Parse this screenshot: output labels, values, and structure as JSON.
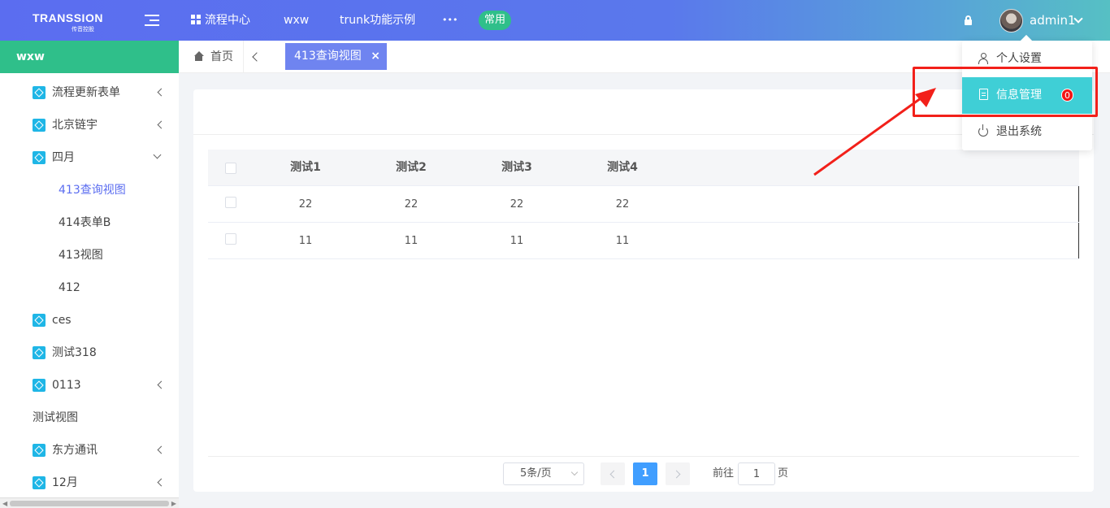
{
  "header": {
    "logo_text": "TRANSSION",
    "logo_subtext": "传音控股",
    "nav": [
      "流程中心",
      "wxw",
      "trunk功能示例",
      "•••"
    ],
    "common_badge": "常用",
    "username": "admin1"
  },
  "sidebar": {
    "title": "wxw",
    "items": [
      {
        "label": "流程更新表单"
      },
      {
        "label": "北京链宇"
      },
      {
        "label": "四月"
      },
      {
        "label": "413查询视图"
      },
      {
        "label": "414表单B"
      },
      {
        "label": "413视图"
      },
      {
        "label": "412"
      },
      {
        "label": "ces"
      },
      {
        "label": "测试318"
      },
      {
        "label": "0113"
      },
      {
        "label": "测试视图"
      },
      {
        "label": "东方通讯"
      },
      {
        "label": "12月"
      }
    ]
  },
  "tabs": {
    "home": "首页",
    "active": "413查询视图",
    "close": "×"
  },
  "table": {
    "headers": [
      "测试1",
      "测试2",
      "测试3",
      "测试4"
    ],
    "rows": [
      [
        "22",
        "22",
        "22",
        "22"
      ],
      [
        "11",
        "11",
        "11",
        "11"
      ]
    ]
  },
  "pagination": {
    "page_size": "5条/页",
    "current_page": "1",
    "goto_label": "前往",
    "goto_value": "1",
    "goto_suffix": "页"
  },
  "user_menu": {
    "items": [
      "个人设置",
      "信息管理",
      "退出系统"
    ],
    "message_count": "0"
  },
  "colors": {
    "header_start": "#5b6df0",
    "header_end": "#56c0c4",
    "sidebar_head": "#2fbf8a",
    "active_tab": "#6f84f0",
    "menu_active": "#3fcfd6",
    "annotation_red": "#f2201a",
    "page_active": "#409eff"
  }
}
